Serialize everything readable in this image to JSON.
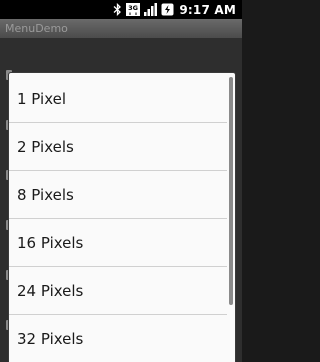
{
  "status_bar": {
    "time": "9:17 AM",
    "icons": [
      "bluetooth-icon",
      "3g-icon",
      "signal-icon",
      "battery-icon"
    ],
    "network_label": "3G"
  },
  "title_bar": {
    "title": "MenuDemo"
  },
  "menu": {
    "items": [
      {
        "label": "1 Pixel"
      },
      {
        "label": "2 Pixels"
      },
      {
        "label": "8 Pixels"
      },
      {
        "label": "16 Pixels"
      },
      {
        "label": "24 Pixels"
      },
      {
        "label": "32 Pixels"
      }
    ]
  },
  "colors": {
    "status_bar_bg": "#000000",
    "title_bar_bg": "#5a5a5a",
    "menu_bg": "#fafafa",
    "menu_text": "#1a1a1a"
  }
}
